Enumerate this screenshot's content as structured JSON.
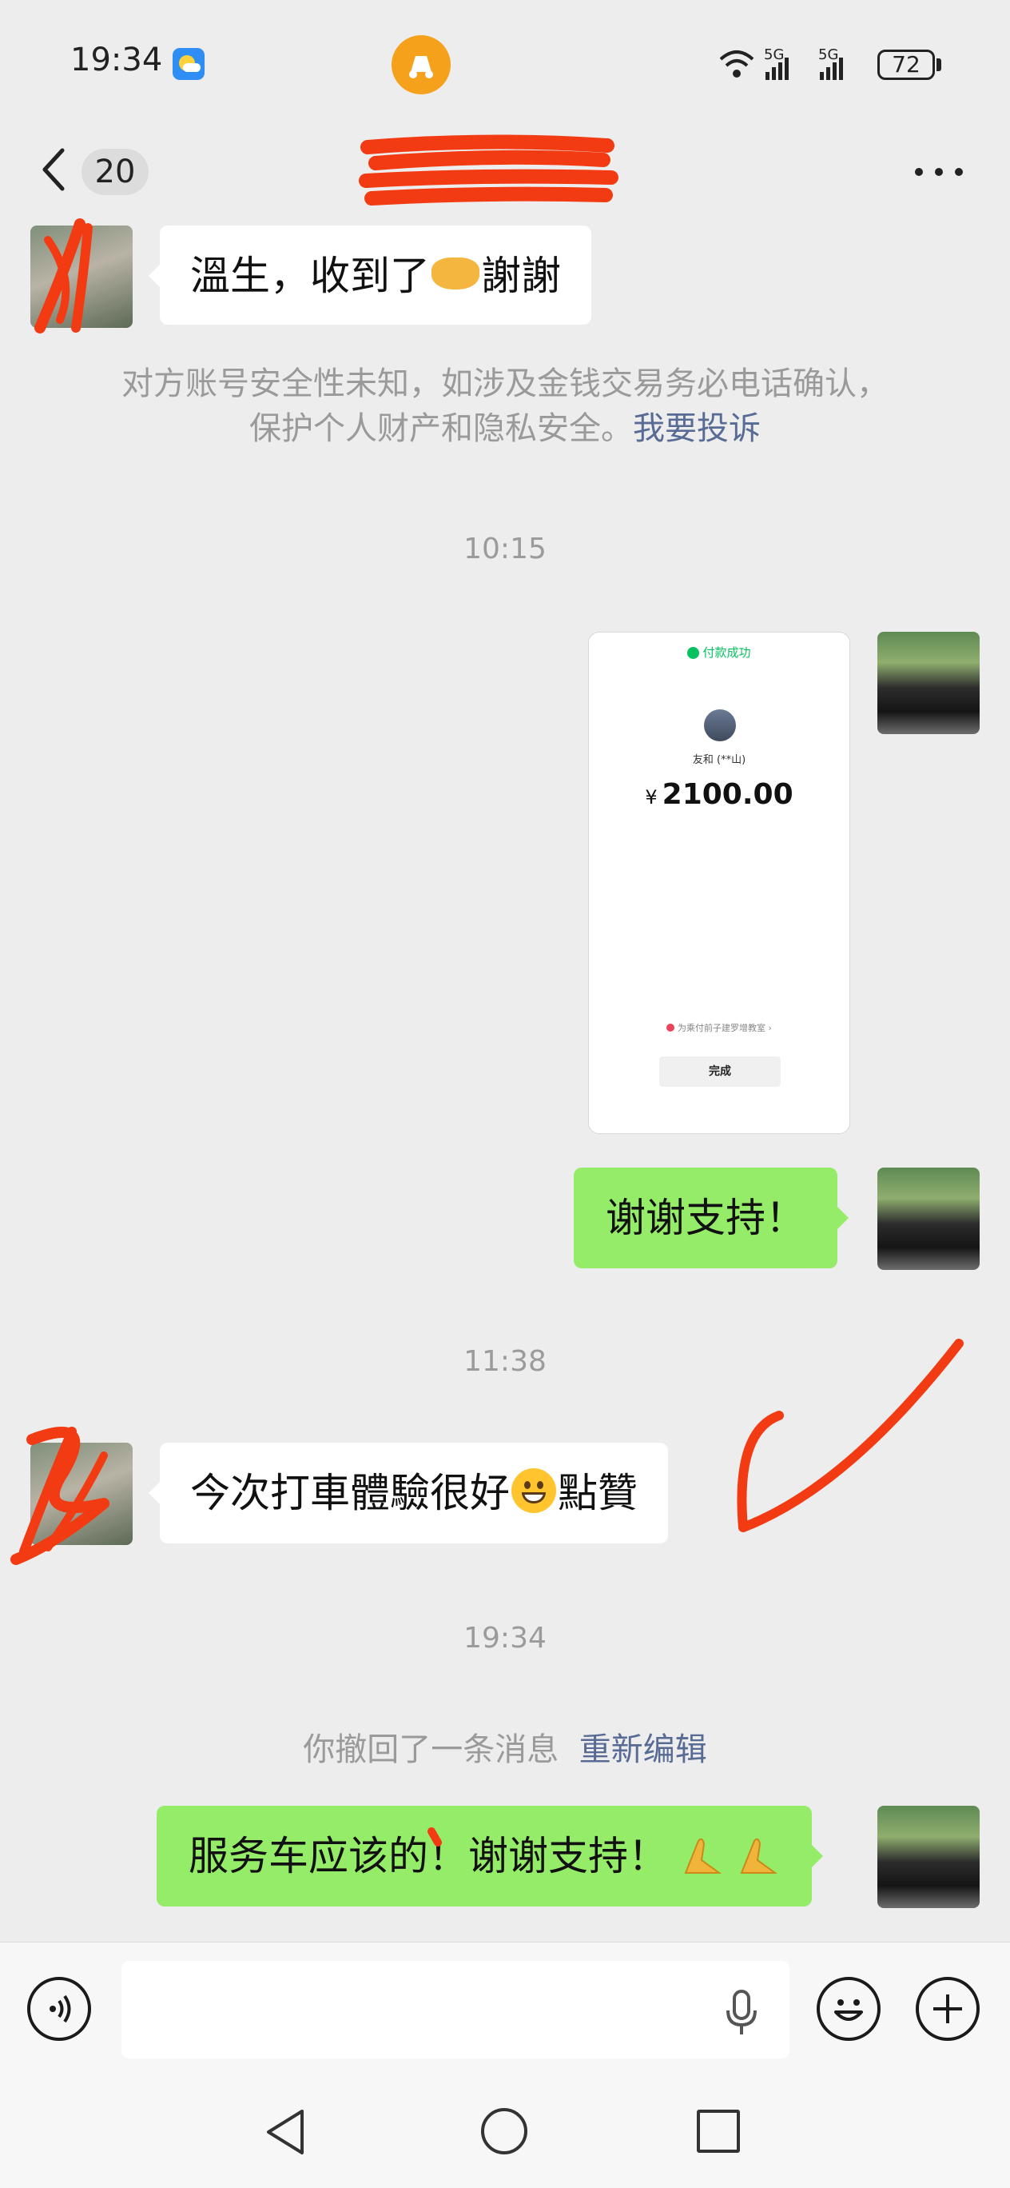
{
  "status_bar": {
    "time": "19:34",
    "signal_1": "5G",
    "signal_2": "5G",
    "battery": "72"
  },
  "nav": {
    "unread_count": "20"
  },
  "messages": {
    "m1": {
      "text_before": "溫生，收到了",
      "text_after": "謝謝"
    },
    "warning": {
      "text": "对方账号安全性未知，如涉及金钱交易务必电话确认，",
      "text_line2": "保护个人财产和隐私安全。",
      "link": "我要投诉"
    },
    "t1": "10:15",
    "payment": {
      "status": "付款成功",
      "payee": "友和 (**山)",
      "currency": "¥",
      "amount": "2100.00",
      "note": "为乘付前子建罗增教室 ›",
      "done_button": "完成"
    },
    "m2": {
      "text": "谢谢支持！"
    },
    "t2": "11:38",
    "m3": {
      "text_before": "今次打車體驗很好",
      "text_after": "點贊"
    },
    "t3": "19:34",
    "recall": {
      "text": "你撤回了一条消息",
      "link": "重新编辑"
    },
    "m4": {
      "text": "服务车应该的！谢谢支持！"
    }
  },
  "input_bar": {
    "value": "",
    "placeholder": ""
  },
  "icons": [
    "back-icon",
    "more-icon",
    "voice-icon",
    "mic-icon",
    "emoji-icon",
    "plus-icon",
    "nav-back-icon",
    "nav-home-icon",
    "nav-recent-icon"
  ],
  "colors": {
    "background": "#ededed",
    "sent_bubble": "#95ec69",
    "received_bubble": "#ffffff",
    "link": "#576b95",
    "redaction": "#f23b12"
  }
}
